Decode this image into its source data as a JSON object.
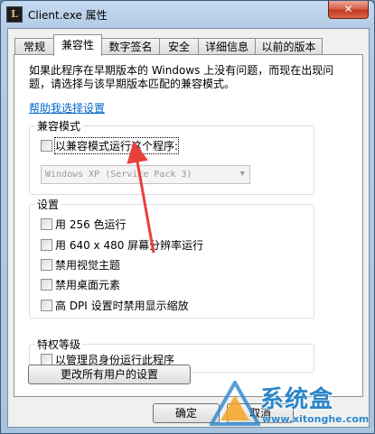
{
  "window": {
    "title": "Client.exe 属性",
    "close_label": "✕"
  },
  "tabs": [
    {
      "label": "常规"
    },
    {
      "label": "兼容性"
    },
    {
      "label": "数字签名"
    },
    {
      "label": "安全"
    },
    {
      "label": "详细信息"
    },
    {
      "label": "以前的版本"
    }
  ],
  "active_tab": "兼容性",
  "intro": {
    "text": "如果此程序在早期版本的 Windows 上没有问题，而现在出现问题，请选择与该早期版本匹配的兼容模式。"
  },
  "help_link": "帮助我选择设置",
  "compat_mode": {
    "title": "兼容模式",
    "checkbox_label": "以兼容模式运行这个程序:",
    "select_value": "Windows XP (Service Pack 3)"
  },
  "settings": {
    "title": "设置",
    "items": [
      {
        "label": "用 256 色运行"
      },
      {
        "label": "用 640 x 480 屏幕分辨率运行"
      },
      {
        "label": "禁用视觉主题"
      },
      {
        "label": "禁用桌面元素"
      },
      {
        "label": "高 DPI 设置时禁用显示缩放"
      }
    ]
  },
  "privilege": {
    "title": "特权等级",
    "checkbox_label": "以管理员身份运行此程序"
  },
  "change_all_button": "更改所有用户的设置",
  "buttons": {
    "ok": "确定",
    "cancel": "取消"
  },
  "watermark": {
    "name": "系统盒",
    "url": "www.xitonghe.com"
  },
  "colors": {
    "annotation_arrow": "#e8413b",
    "link": "#0066cc",
    "watermark": "#2a87c9"
  }
}
